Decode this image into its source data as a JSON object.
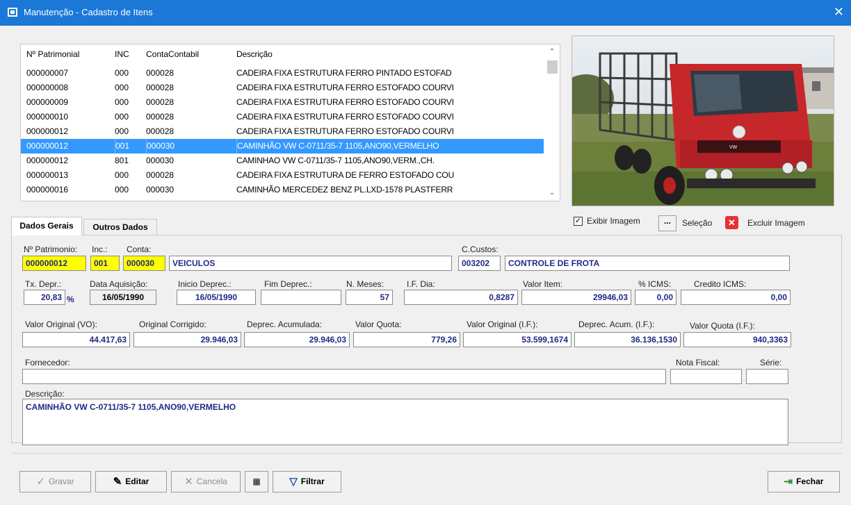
{
  "window": {
    "title": "Manutenção - Cadastro de Itens",
    "close_glyph": "✕"
  },
  "grid": {
    "headers": [
      "Nº Patrimonial",
      "INC",
      "ContaContabil",
      "Descrição"
    ],
    "rows": [
      [
        "000000007",
        "000",
        "000028",
        "CADEIRA FIXA ESTRUTURA FERRO PINTADO ESTOFAD"
      ],
      [
        "000000008",
        "000",
        "000028",
        "CADEIRA FIXA ESTRUTURA FERRO ESTOFADO COURVI"
      ],
      [
        "000000009",
        "000",
        "000028",
        "CADEIRA FIXA ESTRUTURA FERRO ESTOFADO COURVI"
      ],
      [
        "000000010",
        "000",
        "000028",
        "CADEIRA FIXA ESTRUTURA FERRO ESTOFADO COURVI"
      ],
      [
        "000000012",
        "000",
        "000028",
        "CADEIRA FIXA ESTRUTURA FERRO ESTOFADO COURVI"
      ],
      [
        "000000012",
        "001",
        "000030",
        "CAMINHÃO VW C-0711/35-7 1105,ANO90,VERMELHO"
      ],
      [
        "000000012",
        "801",
        "000030",
        "CAMINHAO VW C-0711/35-7 1105,ANO90,VERM.,CH."
      ],
      [
        "000000013",
        "000",
        "000028",
        "CADEIRA FIXA ESTRUTURA DE FERRO ESTOFADO COU"
      ],
      [
        "000000016",
        "000",
        "000030",
        "CAMINHÃO MERCEDEZ BENZ PL.LXD-1578 PLASTFERR"
      ]
    ],
    "selected_row": 5
  },
  "image_controls": {
    "show_label": "Exibir Imagem",
    "show_checked": true,
    "browse_label": "...",
    "select_label": "Seleção",
    "delete_label": "Excluir Imagem"
  },
  "tabs": [
    "Dados Gerais",
    "Outros Dados"
  ],
  "form": {
    "patrimonio": {
      "label": "Nº Patrimonio:",
      "value": "000000012"
    },
    "inc": {
      "label": "Inc.:",
      "value": "001"
    },
    "conta": {
      "label": "Conta:",
      "value": "000030",
      "desc": "VEICULOS"
    },
    "ccustos": {
      "label": "C.Custos:",
      "value": "003202",
      "desc": "CONTROLE DE FROTA"
    },
    "tx_depr": {
      "label": "Tx. Depr.:",
      "value": "20,83",
      "unit": "%"
    },
    "data_aquisicao": {
      "label": "Data Aquisição:",
      "value": "16/05/1990"
    },
    "inicio_deprec": {
      "label": "Inicio Deprec.:",
      "value": "16/05/1990"
    },
    "fim_deprec": {
      "label": "Fim Deprec.:",
      "value": ""
    },
    "n_meses": {
      "label": "N. Meses:",
      "value": "57"
    },
    "if_dia": {
      "label": "I.F. Dia:",
      "value": "0,8287"
    },
    "valor_item": {
      "label": "Valor Item:",
      "value": "29946,03"
    },
    "pct_icms": {
      "label": "% ICMS:",
      "value": "0,00"
    },
    "credito_icms": {
      "label": "Credito ICMS:",
      "value": "0,00"
    },
    "valor_original": {
      "label": "Valor Original (VO):",
      "value": "44.417,63"
    },
    "original_corrigido": {
      "label": "Original  Corrigido:",
      "value": "29.946,03"
    },
    "deprec_acumulada": {
      "label": "Deprec. Acumulada:",
      "value": "29.946,03"
    },
    "valor_quota": {
      "label": "Valor Quota:",
      "value": "779,26"
    },
    "valor_original_if": {
      "label": "Valor Original (I.F.):",
      "value": "53.599,1674"
    },
    "deprec_acum_if": {
      "label": "Deprec. Acum. (I.F.):",
      "value": "36.136,1530"
    },
    "valor_quota_if": {
      "label": "Valor Quota (I.F.):",
      "value": "940,3363"
    },
    "fornecedor": {
      "label": "Fornecedor:",
      "value": ""
    },
    "nota_fiscal": {
      "label": "Nota Fiscal:",
      "value": ""
    },
    "serie": {
      "label": "Série:",
      "value": ""
    },
    "descricao": {
      "label": "Descrição:",
      "value": "CAMINHÃO VW C-0711/35-7 1105,ANO90,VERMELHO"
    }
  },
  "buttons": {
    "gravar": "Gravar",
    "editar": "Editar",
    "cancela": "Cancela",
    "filtrar": "Filtrar",
    "fechar": "Fechar"
  },
  "colors": {
    "selection": "#3399ff",
    "titlebar": "#1b78d6",
    "key_field": "#ffff00",
    "value_text": "#1f2a84"
  }
}
